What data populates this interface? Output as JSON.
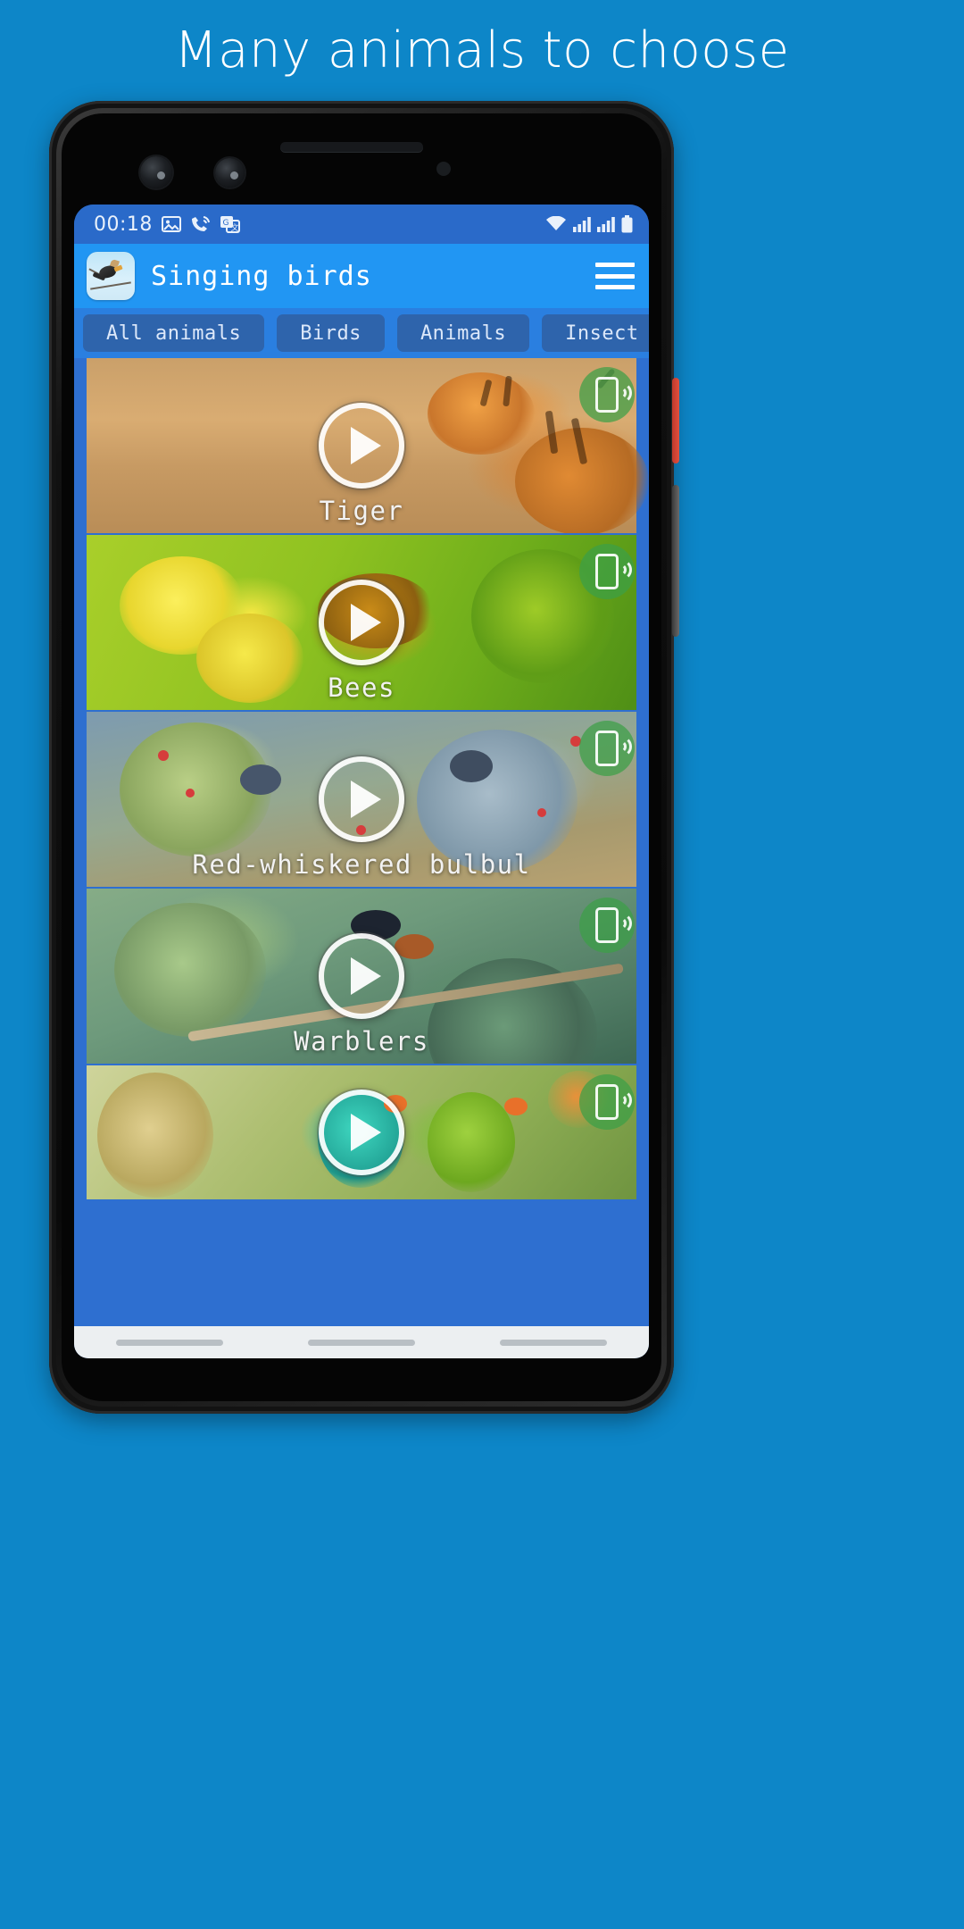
{
  "headline": "Many animals to choose",
  "colors": {
    "page_background": "#0d86c8",
    "appbar": "#2196f3",
    "statusbar": "#2a6ac9",
    "tab_bar": "#2a7fe0",
    "tab_chip": "#2e64ac",
    "list_background": "#2e6fd0",
    "ringtone_badge": "#3ca046"
  },
  "phone": {
    "statusbar": {
      "time": "00:18",
      "left_icons": [
        "image-icon",
        "phone-call-waves-icon",
        "google-translate-icon"
      ],
      "right_icons": [
        "wifi-icon",
        "signal-bars-icon",
        "signal-bars-2-icon",
        "battery-icon"
      ]
    },
    "appbar": {
      "logo_icon": "app-logo-bird-icon",
      "title": "Singing birds",
      "menu_icon": "hamburger-menu-icon"
    },
    "tabs": [
      {
        "label": "All animals",
        "selected": true
      },
      {
        "label": "Birds",
        "selected": false
      },
      {
        "label": "Animals",
        "selected": false
      },
      {
        "label": "Insect",
        "selected": false
      }
    ],
    "list": [
      {
        "name": "Tiger",
        "photo": "tiger-photo",
        "play_icon": "play-icon",
        "ringtone_icon": "set-as-ringtone-icon"
      },
      {
        "name": "Bees",
        "photo": "bee-on-yellow-flower-photo",
        "play_icon": "play-icon",
        "ringtone_icon": "set-as-ringtone-icon"
      },
      {
        "name": "Red-whiskered bulbul",
        "photo": "two-bulbuls-on-branch-photo",
        "play_icon": "play-icon",
        "ringtone_icon": "set-as-ringtone-icon"
      },
      {
        "name": "Warblers",
        "photo": "warbler-on-branch-photo",
        "play_icon": "play-icon",
        "ringtone_icon": "set-as-ringtone-icon"
      },
      {
        "name": "",
        "photo": "lovebirds-photo",
        "play_icon": "play-icon",
        "ringtone_icon": "set-as-ringtone-icon"
      }
    ],
    "navbar": {
      "back_icon": "nav-back-pill",
      "home_icon": "nav-home-pill",
      "recents_icon": "nav-recents-pill"
    }
  }
}
